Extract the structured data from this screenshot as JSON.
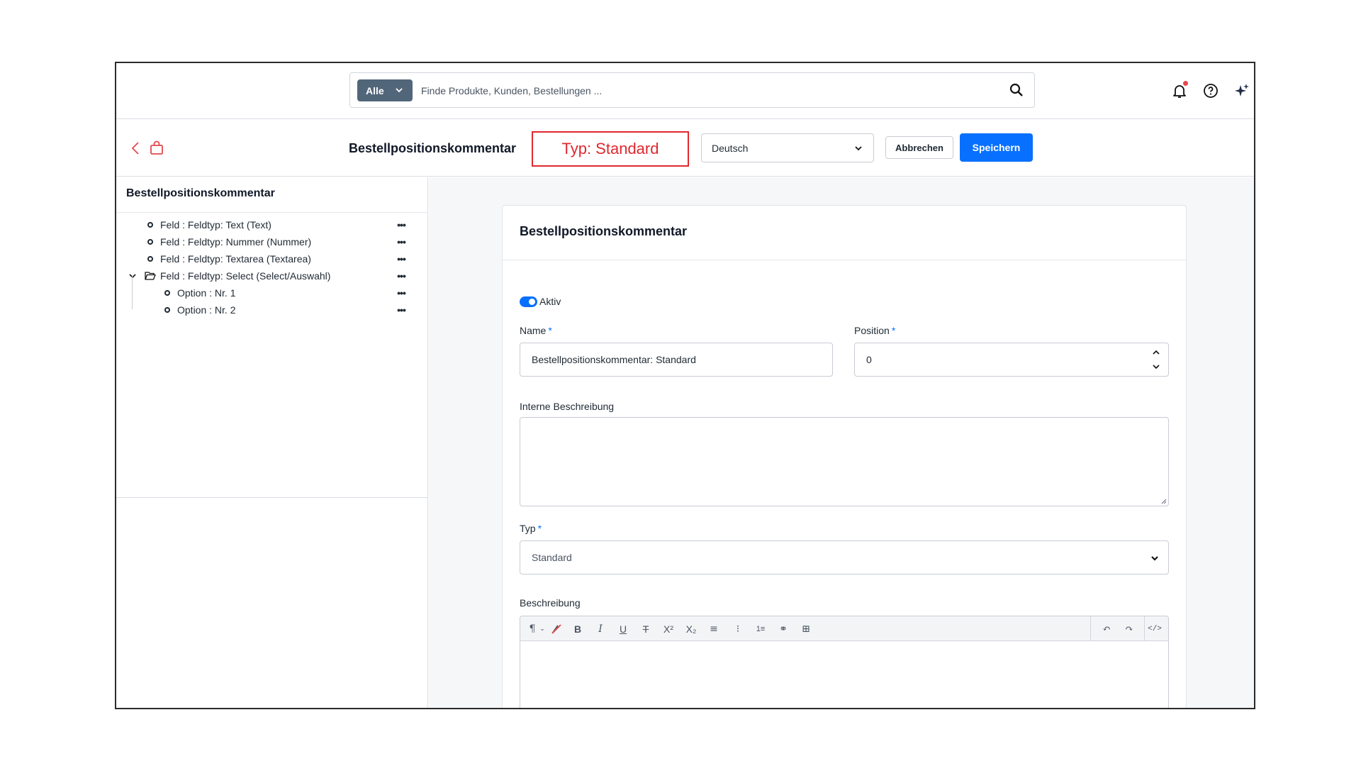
{
  "search": {
    "category": "Alle",
    "placeholder": "Finde Produkte, Kunden, Bestellungen ..."
  },
  "header": {
    "title": "Bestellpositionskommentar",
    "type_badge": "Typ: Standard",
    "language": "Deutsch",
    "cancel_label": "Abbrechen",
    "save_label": "Speichern"
  },
  "sidebar": {
    "title": "Bestellpositionskommentar",
    "items": [
      {
        "label": "Feld : Feldtyp: Text (Text)",
        "level": 1
      },
      {
        "label": "Feld : Feldtyp: Nummer (Nummer)",
        "level": 1
      },
      {
        "label": "Feld : Feldtyp: Textarea (Textarea)",
        "level": 1
      },
      {
        "label": "Feld : Feldtyp: Select (Select/Auswahl)",
        "level": 1,
        "expanded": true
      },
      {
        "label": "Option : Nr. 1",
        "level": 2
      },
      {
        "label": "Option : Nr. 2",
        "level": 2
      }
    ]
  },
  "form": {
    "card_title": "Bestellpositionskommentar",
    "active_label": "Aktiv",
    "active": true,
    "name_label": "Name",
    "name_value": "Bestellpositionskommentar: Standard",
    "position_label": "Position",
    "position_value": "0",
    "internal_desc_label": "Interne Beschreibung",
    "type_label": "Typ",
    "type_value": "Standard",
    "desc_label": "Beschreibung",
    "required_mark": "*"
  },
  "colors": {
    "primary": "#0870ff",
    "badge_red": "#e0282e",
    "category_bg": "#52667a"
  },
  "icons": [
    "search-icon",
    "bell-icon",
    "help-icon",
    "sparkle-icon",
    "back-icon",
    "shopping-bag-icon",
    "more-icon",
    "folder-open-icon",
    "chevron-down-icon"
  ]
}
